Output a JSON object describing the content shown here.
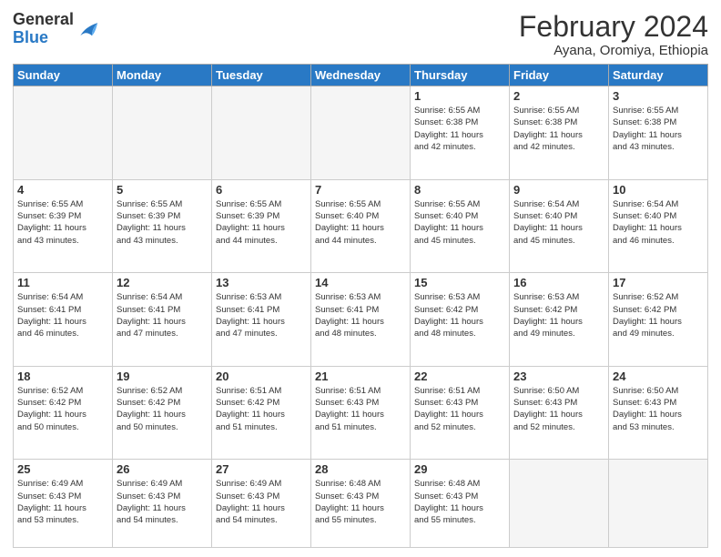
{
  "logo": {
    "general": "General",
    "blue": "Blue"
  },
  "header": {
    "month_year": "February 2024",
    "location": "Ayana, Oromiya, Ethiopia"
  },
  "days_of_week": [
    "Sunday",
    "Monday",
    "Tuesday",
    "Wednesday",
    "Thursday",
    "Friday",
    "Saturday"
  ],
  "weeks": [
    [
      {
        "day": "",
        "info": ""
      },
      {
        "day": "",
        "info": ""
      },
      {
        "day": "",
        "info": ""
      },
      {
        "day": "",
        "info": ""
      },
      {
        "day": "1",
        "info": "Sunrise: 6:55 AM\nSunset: 6:38 PM\nDaylight: 11 hours\nand 42 minutes."
      },
      {
        "day": "2",
        "info": "Sunrise: 6:55 AM\nSunset: 6:38 PM\nDaylight: 11 hours\nand 42 minutes."
      },
      {
        "day": "3",
        "info": "Sunrise: 6:55 AM\nSunset: 6:38 PM\nDaylight: 11 hours\nand 43 minutes."
      }
    ],
    [
      {
        "day": "4",
        "info": "Sunrise: 6:55 AM\nSunset: 6:39 PM\nDaylight: 11 hours\nand 43 minutes."
      },
      {
        "day": "5",
        "info": "Sunrise: 6:55 AM\nSunset: 6:39 PM\nDaylight: 11 hours\nand 43 minutes."
      },
      {
        "day": "6",
        "info": "Sunrise: 6:55 AM\nSunset: 6:39 PM\nDaylight: 11 hours\nand 44 minutes."
      },
      {
        "day": "7",
        "info": "Sunrise: 6:55 AM\nSunset: 6:40 PM\nDaylight: 11 hours\nand 44 minutes."
      },
      {
        "day": "8",
        "info": "Sunrise: 6:55 AM\nSunset: 6:40 PM\nDaylight: 11 hours\nand 45 minutes."
      },
      {
        "day": "9",
        "info": "Sunrise: 6:54 AM\nSunset: 6:40 PM\nDaylight: 11 hours\nand 45 minutes."
      },
      {
        "day": "10",
        "info": "Sunrise: 6:54 AM\nSunset: 6:40 PM\nDaylight: 11 hours\nand 46 minutes."
      }
    ],
    [
      {
        "day": "11",
        "info": "Sunrise: 6:54 AM\nSunset: 6:41 PM\nDaylight: 11 hours\nand 46 minutes."
      },
      {
        "day": "12",
        "info": "Sunrise: 6:54 AM\nSunset: 6:41 PM\nDaylight: 11 hours\nand 47 minutes."
      },
      {
        "day": "13",
        "info": "Sunrise: 6:53 AM\nSunset: 6:41 PM\nDaylight: 11 hours\nand 47 minutes."
      },
      {
        "day": "14",
        "info": "Sunrise: 6:53 AM\nSunset: 6:41 PM\nDaylight: 11 hours\nand 48 minutes."
      },
      {
        "day": "15",
        "info": "Sunrise: 6:53 AM\nSunset: 6:42 PM\nDaylight: 11 hours\nand 48 minutes."
      },
      {
        "day": "16",
        "info": "Sunrise: 6:53 AM\nSunset: 6:42 PM\nDaylight: 11 hours\nand 49 minutes."
      },
      {
        "day": "17",
        "info": "Sunrise: 6:52 AM\nSunset: 6:42 PM\nDaylight: 11 hours\nand 49 minutes."
      }
    ],
    [
      {
        "day": "18",
        "info": "Sunrise: 6:52 AM\nSunset: 6:42 PM\nDaylight: 11 hours\nand 50 minutes."
      },
      {
        "day": "19",
        "info": "Sunrise: 6:52 AM\nSunset: 6:42 PM\nDaylight: 11 hours\nand 50 minutes."
      },
      {
        "day": "20",
        "info": "Sunrise: 6:51 AM\nSunset: 6:42 PM\nDaylight: 11 hours\nand 51 minutes."
      },
      {
        "day": "21",
        "info": "Sunrise: 6:51 AM\nSunset: 6:43 PM\nDaylight: 11 hours\nand 51 minutes."
      },
      {
        "day": "22",
        "info": "Sunrise: 6:51 AM\nSunset: 6:43 PM\nDaylight: 11 hours\nand 52 minutes."
      },
      {
        "day": "23",
        "info": "Sunrise: 6:50 AM\nSunset: 6:43 PM\nDaylight: 11 hours\nand 52 minutes."
      },
      {
        "day": "24",
        "info": "Sunrise: 6:50 AM\nSunset: 6:43 PM\nDaylight: 11 hours\nand 53 minutes."
      }
    ],
    [
      {
        "day": "25",
        "info": "Sunrise: 6:49 AM\nSunset: 6:43 PM\nDaylight: 11 hours\nand 53 minutes."
      },
      {
        "day": "26",
        "info": "Sunrise: 6:49 AM\nSunset: 6:43 PM\nDaylight: 11 hours\nand 54 minutes."
      },
      {
        "day": "27",
        "info": "Sunrise: 6:49 AM\nSunset: 6:43 PM\nDaylight: 11 hours\nand 54 minutes."
      },
      {
        "day": "28",
        "info": "Sunrise: 6:48 AM\nSunset: 6:43 PM\nDaylight: 11 hours\nand 55 minutes."
      },
      {
        "day": "29",
        "info": "Sunrise: 6:48 AM\nSunset: 6:43 PM\nDaylight: 11 hours\nand 55 minutes."
      },
      {
        "day": "",
        "info": ""
      },
      {
        "day": "",
        "info": ""
      }
    ]
  ]
}
